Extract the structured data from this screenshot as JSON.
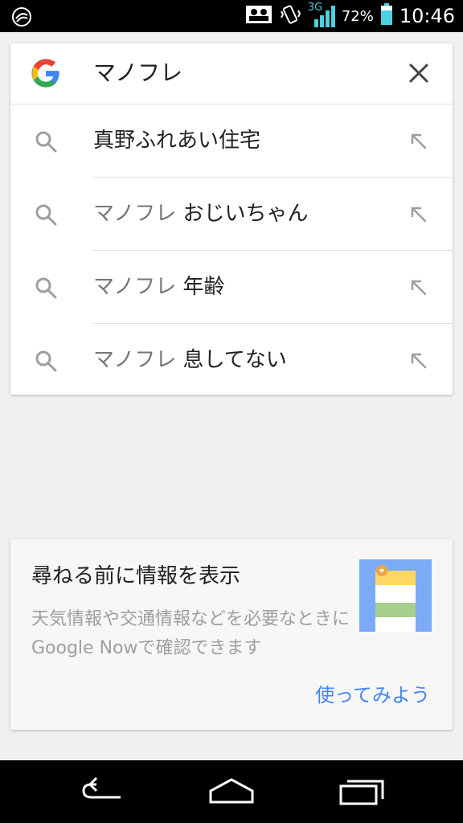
{
  "status_bar": {
    "network": "3G",
    "battery_percent": "72%",
    "time": "10:46",
    "icons": [
      "app-notification-icon",
      "contact-card-icon",
      "vibrate-icon",
      "signal-icon",
      "battery-icon"
    ]
  },
  "search": {
    "query": "マノフレ",
    "suggestions": [
      {
        "prefix": "",
        "suffix": "真野ふれあい住宅"
      },
      {
        "prefix": "マノフレ ",
        "suffix": "おじいちゃん"
      },
      {
        "prefix": "マノフレ ",
        "suffix": "年齢"
      },
      {
        "prefix": "マノフレ ",
        "suffix": "息してない"
      }
    ]
  },
  "now_card": {
    "title": "尋ねる前に情報を表示",
    "body": "天気情報や交通情報などを必要なときにGoogle Nowで確認できます",
    "cta": "使ってみよう"
  },
  "colors": {
    "google_blue": "#4285f4",
    "google_red": "#ea4335",
    "google_yellow": "#fbbc05",
    "google_green": "#34a853"
  }
}
